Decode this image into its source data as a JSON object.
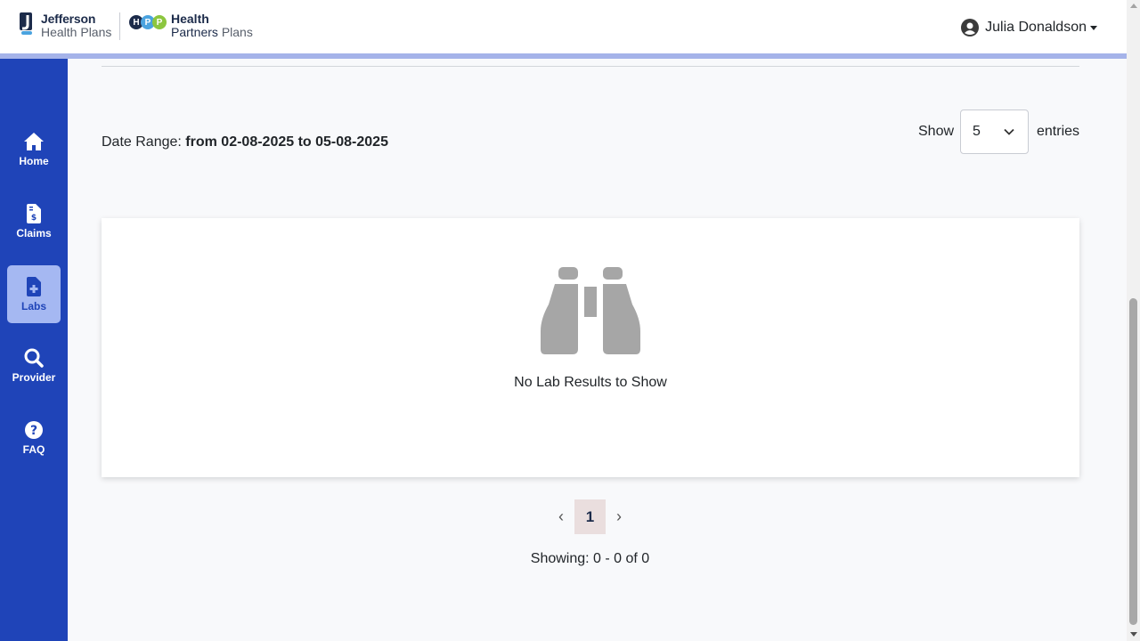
{
  "header": {
    "brand_jefferson_line1": "Jefferson",
    "brand_jefferson_line2": "Health Plans",
    "brand_hpp_circles": [
      "H",
      "P",
      "P"
    ],
    "brand_hpp_line1": "Health",
    "brand_hpp_line2a": "Partners",
    "brand_hpp_line2b": "Plans",
    "user_name": "Julia Donaldson"
  },
  "sidebar": {
    "items": [
      {
        "label": "Home",
        "icon": "home-icon"
      },
      {
        "label": "Claims",
        "icon": "invoice-dollar-icon"
      },
      {
        "label": "Labs",
        "icon": "file-medical-icon",
        "active": true
      },
      {
        "label": "Provider",
        "icon": "search-icon"
      },
      {
        "label": "FAQ",
        "icon": "question-circle-icon"
      }
    ]
  },
  "filters": {
    "date_range_label": "Date Range:",
    "date_range_value": "from 02-08-2025 to 05-08-2025",
    "show_label": "Show",
    "entries_value": "5",
    "entries_label": "entries"
  },
  "results": {
    "empty_message": "No Lab Results to Show",
    "empty_icon": "binoculars-icon"
  },
  "pagination": {
    "prev": "‹",
    "current_page": "1",
    "next": "›",
    "showing_text": "Showing: 0 - 0 of 0"
  },
  "colors": {
    "sidebar": "#1f44b8",
    "active_nav": "#a5b8f2",
    "header_border": "#a5b3e9",
    "hpp_h": "#1c2b4a",
    "hpp_p1": "#4aa3df",
    "hpp_p2": "#8cc63f"
  }
}
